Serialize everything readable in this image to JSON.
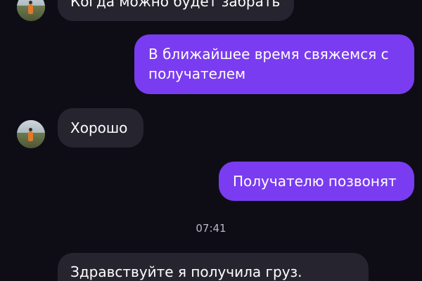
{
  "messages": [
    {
      "direction": "incoming",
      "text": "Когда можно будет забрать",
      "has_avatar": true
    },
    {
      "direction": "outgoing",
      "text_line1": "В ближайшее время свяжемся с",
      "text_line2": "получателем"
    },
    {
      "direction": "incoming",
      "text": "Хорошо",
      "has_avatar": true
    },
    {
      "direction": "outgoing",
      "text": "Получателю позвонят"
    },
    {
      "direction": "incoming",
      "text": "Здравствуйте я получила груз."
    }
  ],
  "timestamp": "07:41",
  "colors": {
    "background": "#0e0d16",
    "incoming_bubble": "#26252f",
    "outgoing_bubble": "#7a3cf0",
    "timestamp_text": "#b9b7c4"
  },
  "icons": {
    "avatar": "user-avatar-photo"
  }
}
